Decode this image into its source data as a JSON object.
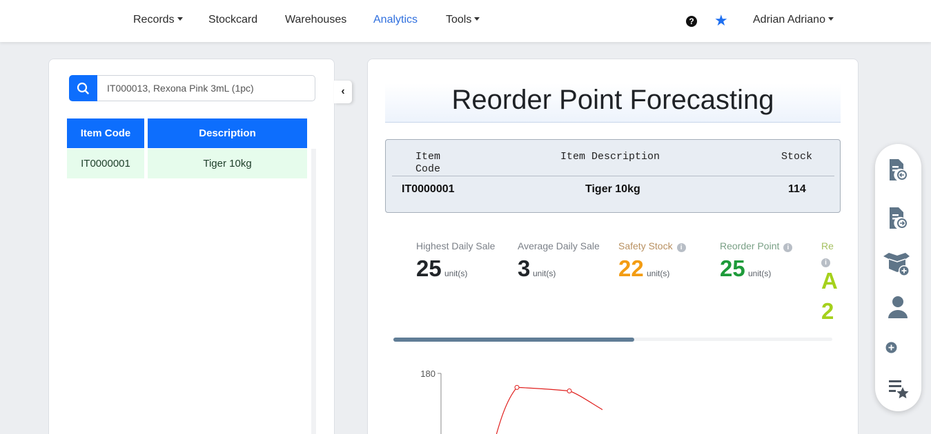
{
  "nav": {
    "items": [
      {
        "label": "Records",
        "dropdown": true
      },
      {
        "label": "Stockcard",
        "dropdown": false
      },
      {
        "label": "Warehouses",
        "dropdown": false
      },
      {
        "label": "Analytics",
        "dropdown": false,
        "active": true
      },
      {
        "label": "Tools",
        "dropdown": true
      }
    ],
    "help_icon": "question-circle-icon",
    "star_icon": "star-icon",
    "user_name": "Adrian Adriano"
  },
  "search": {
    "value": "IT000013, Rexona Pink 3mL (1pc)",
    "icon": "search-icon"
  },
  "item_table": {
    "headers": [
      "Item Code",
      "Description"
    ],
    "rows": [
      {
        "code": "IT0000001",
        "description": "Tiger 10kg"
      }
    ]
  },
  "forecast": {
    "title": "Reorder Point Forecasting",
    "info_headers": {
      "code": "Item\nCode",
      "description": "Item Description",
      "stock": "Stock"
    },
    "info_row": {
      "code": "IT0000001",
      "description": "Tiger 10kg",
      "stock": "114"
    },
    "stats": [
      {
        "label": "Highest Daily Sale",
        "value": "25",
        "unit": "unit(s)",
        "color": "#212529",
        "info": false
      },
      {
        "label": "Average Daily Sale",
        "value": "3",
        "unit": "unit(s)",
        "color": "#212529",
        "info": false
      },
      {
        "label": "Safety Stock",
        "value": "22",
        "unit": "unit(s)",
        "color": "#f39c12",
        "info": true
      },
      {
        "label": "Reorder Point",
        "value": "25",
        "unit": "unit(s)",
        "color": "#1e9b3a",
        "info": true
      },
      {
        "label": "Re",
        "value": "A",
        "value2": "2",
        "color": "#a5d11c",
        "info": true
      }
    ],
    "scroll_position": 0.55
  },
  "chart_data": {
    "type": "line",
    "y_tick_visible": "180",
    "series": [
      {
        "values": [
          150,
          172,
          170,
          160
        ],
        "color": "#e0201e"
      }
    ]
  },
  "side_toolbar": {
    "icons": [
      "file-import-icon",
      "file-export-icon",
      "box-add-icon",
      "user-icon",
      "add-circle-icon",
      "list-star-icon"
    ]
  }
}
